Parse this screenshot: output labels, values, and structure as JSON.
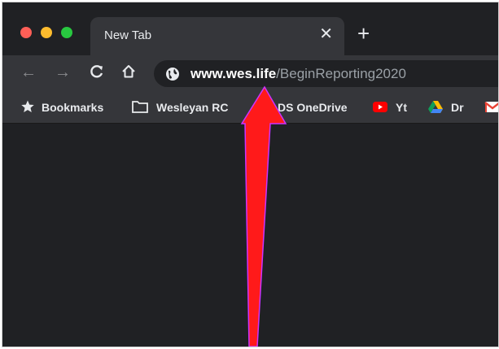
{
  "tab": {
    "title": "New Tab",
    "close_glyph": "✕"
  },
  "new_tab_glyph": "+",
  "nav": {
    "back_glyph": "←",
    "forward_glyph": "→",
    "reload_glyph": "C",
    "home_glyph": "⌂"
  },
  "address": {
    "host": "www.wes.life",
    "path": "/BeginReporting2020"
  },
  "bookmarks": [
    {
      "label": "Bookmarks",
      "icon": "star-icon"
    },
    {
      "label": "Wesleyan RC",
      "icon": "folder-icon"
    },
    {
      "label": "DS OneDrive",
      "icon": "folder-icon"
    },
    {
      "label": "Yt",
      "icon": "youtube-icon"
    },
    {
      "label": "Dr",
      "icon": "google-drive-icon"
    },
    {
      "label": "",
      "icon": "gmail-icon"
    }
  ],
  "colors": {
    "arrow": "#ff1a1a",
    "arrow_outline": "#cc33ff",
    "window_bg": "#202124",
    "toolbar_bg": "#35363a"
  }
}
